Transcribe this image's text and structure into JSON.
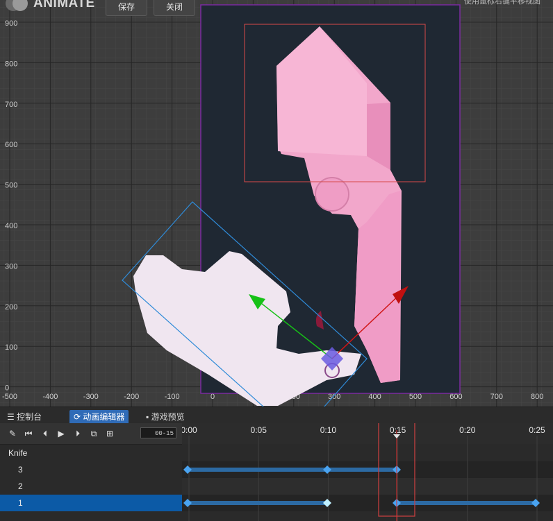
{
  "app": {
    "logo_text": "ANIMATE",
    "save_label": "保存",
    "close_label": "关闭",
    "hint_text": "使用鼠标右键平移视图"
  },
  "viewport": {
    "x_axis_labels": [
      "-500",
      "-400",
      "-300",
      "-200",
      "-100",
      "0",
      "100",
      "200",
      "300",
      "400",
      "500",
      "600",
      "700",
      "800"
    ],
    "y_axis_labels": [
      "900",
      "800",
      "700",
      "600",
      "500",
      "400",
      "300",
      "200",
      "100",
      "0"
    ]
  },
  "tabs": [
    {
      "label": "控制台",
      "icon": "list-icon"
    },
    {
      "label": "动画编辑器",
      "icon": "animation-icon"
    },
    {
      "label": "游戏预览",
      "icon": "camera-icon"
    }
  ],
  "toolbar": {
    "frame_value": "00-15",
    "tools": [
      "edit-icon",
      "skip-first-icon",
      "prev-frame-icon",
      "play-icon",
      "next-frame-icon",
      "export-icon",
      "add-icon"
    ]
  },
  "tracks": [
    {
      "label": "Knife",
      "selected": false
    },
    {
      "label": "3",
      "selected": false
    },
    {
      "label": "2",
      "selected": false
    },
    {
      "label": "1",
      "selected": true
    }
  ],
  "timeline": {
    "ruler_labels": [
      "0:00",
      "0:05",
      "0:10",
      "0:15",
      "0:20",
      "0:25"
    ],
    "current_time": "0:15"
  },
  "colors": {
    "accent": "#2f6bb7",
    "keyframe": "#4aa3f0",
    "canvas": "#1f2833",
    "sprite_pink": "#f0a2c8",
    "sprite_white": "#f1e6f0",
    "arrow_green": "#17c117",
    "arrow_red": "#d01414"
  }
}
